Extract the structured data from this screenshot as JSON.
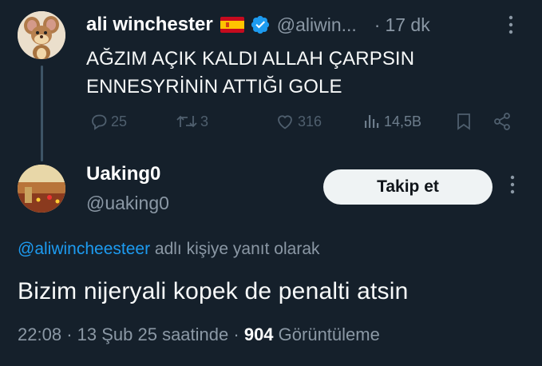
{
  "parent_tweet": {
    "author_name": "ali winchester",
    "flag": "🇪🇸",
    "handle": "@aliwin...",
    "separator": "·",
    "time": "17 dk",
    "text_lines": [
      "AĞZIM AÇIK KALDI ALLAH ÇARPSIN",
      "ENNESYRİNİN ATTIĞI GOLE"
    ],
    "actions": {
      "replies": "25",
      "retweets": "3",
      "likes": "316",
      "views": "14,5B"
    }
  },
  "reply": {
    "author_name": "Uaking0",
    "handle": "@uaking0",
    "follow_label": "Takip et",
    "reply_to_mention": "@aliwincheesteer",
    "reply_to_suffix": " adlı kişiye yanıt olarak",
    "text": "Bizim nijeryali kopek de penalti atsin",
    "meta": {
      "time": "22:08",
      "sep": "·",
      "date": "13 Şub 25 saatinde",
      "sep2": "·",
      "views_count": "904",
      "views_label": " Görüntüleme"
    }
  },
  "colors": {
    "background": "#15202b",
    "accent": "#1d9bf0",
    "secondary_text": "#8b98a5",
    "verified": "#1d9bf0"
  },
  "icons": [
    "jerry-mouse-avatar",
    "spain-flag-icon",
    "verified-badge-icon",
    "reply-icon",
    "retweet-icon",
    "like-icon",
    "views-icon",
    "bookmark-icon",
    "share-icon",
    "more-icon",
    "stadium-avatar"
  ]
}
